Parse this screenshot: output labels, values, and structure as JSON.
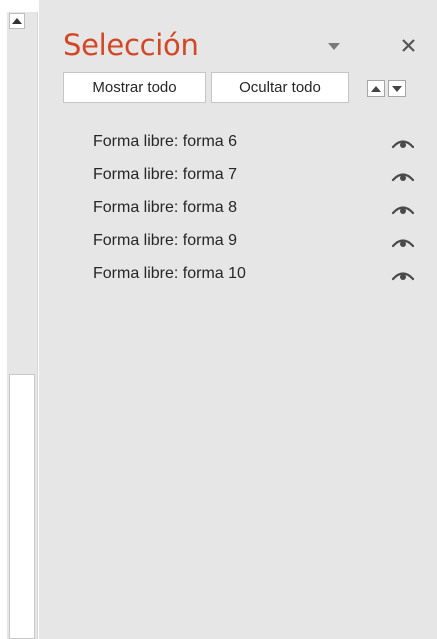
{
  "pane": {
    "title": "Selección",
    "show_all": "Mostrar todo",
    "hide_all": "Ocultar todo",
    "close_icon": "close-icon",
    "options_icon": "chevron-down-icon",
    "accent_color": "#d24726",
    "background": "#e6e6e6"
  },
  "items": [
    {
      "label": "Forma libre: forma 6",
      "visible": true
    },
    {
      "label": "Forma libre: forma 7",
      "visible": true
    },
    {
      "label": "Forma libre: forma 8",
      "visible": true
    },
    {
      "label": "Forma libre: forma 9",
      "visible": true
    },
    {
      "label": "Forma libre: forma 10",
      "visible": true
    }
  ]
}
